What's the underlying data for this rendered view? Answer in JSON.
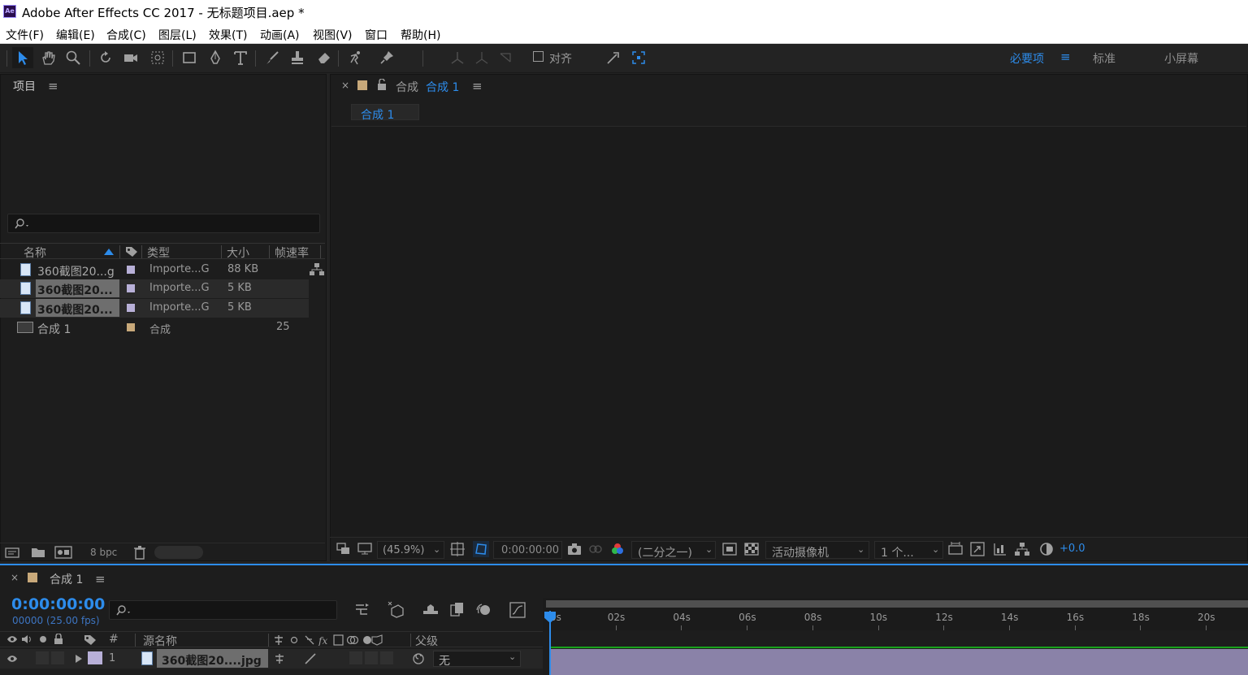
{
  "window": {
    "title": "Adobe After Effects CC 2017 - 无标题项目.aep *",
    "app_icon_text": "Ae"
  },
  "menu": [
    "文件(F)",
    "编辑(E)",
    "合成(C)",
    "图层(L)",
    "效果(T)",
    "动画(A)",
    "视图(V)",
    "窗口",
    "帮助(H)"
  ],
  "toolbar": {
    "tools": [
      "selection-tool",
      "hand-tool",
      "zoom-tool",
      "rotate-tool",
      "camera-tool",
      "pan-behind-tool",
      "rectangle-tool",
      "pen-tool",
      "type-tool",
      "brush-tool",
      "clone-stamp-tool",
      "eraser-tool",
      "roto-brush-tool",
      "puppet-pin-tool"
    ],
    "align_label": "对齐",
    "workspaces": [
      "必要项",
      "标准",
      "小屏幕"
    ]
  },
  "project": {
    "title": "项目",
    "columns": [
      "名称",
      "类型",
      "大小",
      "帧速率"
    ],
    "items": [
      {
        "name": "360截图20...g",
        "type": "Importe...G",
        "size": "88 KB",
        "fps": "",
        "color": "#b8b0d8",
        "selected": false
      },
      {
        "name": "360截图20...",
        "type": "Importe...G",
        "size": "5 KB",
        "fps": "",
        "color": "#b8b0d8",
        "selected": true
      },
      {
        "name": "360截图20...",
        "type": "Importe...G",
        "size": "5 KB",
        "fps": "",
        "color": "#b8b0d8",
        "selected": true
      },
      {
        "name": "合成 1",
        "type": "合成",
        "size": "",
        "fps": "25",
        "color": "#c8a97a",
        "selected": false
      }
    ],
    "bpc": "8 bpc"
  },
  "composition": {
    "tab_prefix": "合成",
    "tab_name": "合成 1",
    "breadcrumb": "合成 1",
    "zoom": "(45.9%)",
    "timecode": "0:00:00:00",
    "resolution": "(二分之一)",
    "camera": "活动摄像机",
    "views": "1 个...",
    "exposure": "+0.0"
  },
  "timeline": {
    "tab_name": "合成 1",
    "timecode": "0:00:00:00",
    "fps_label": "00000 (25.00 fps)",
    "columns": {
      "index": "#",
      "source_name": "源名称",
      "parent": "父级"
    },
    "ruler": [
      "0s",
      "02s",
      "04s",
      "06s",
      "08s",
      "10s",
      "12s",
      "14s",
      "16s",
      "18s",
      "20s"
    ],
    "layers": [
      {
        "index": "1",
        "name": "360截图20....jpg",
        "parent": "无"
      }
    ]
  },
  "colors": {
    "accent": "#2d8ceb",
    "panel": "#1d1d1d",
    "layer_bar": "#8a82a8"
  }
}
